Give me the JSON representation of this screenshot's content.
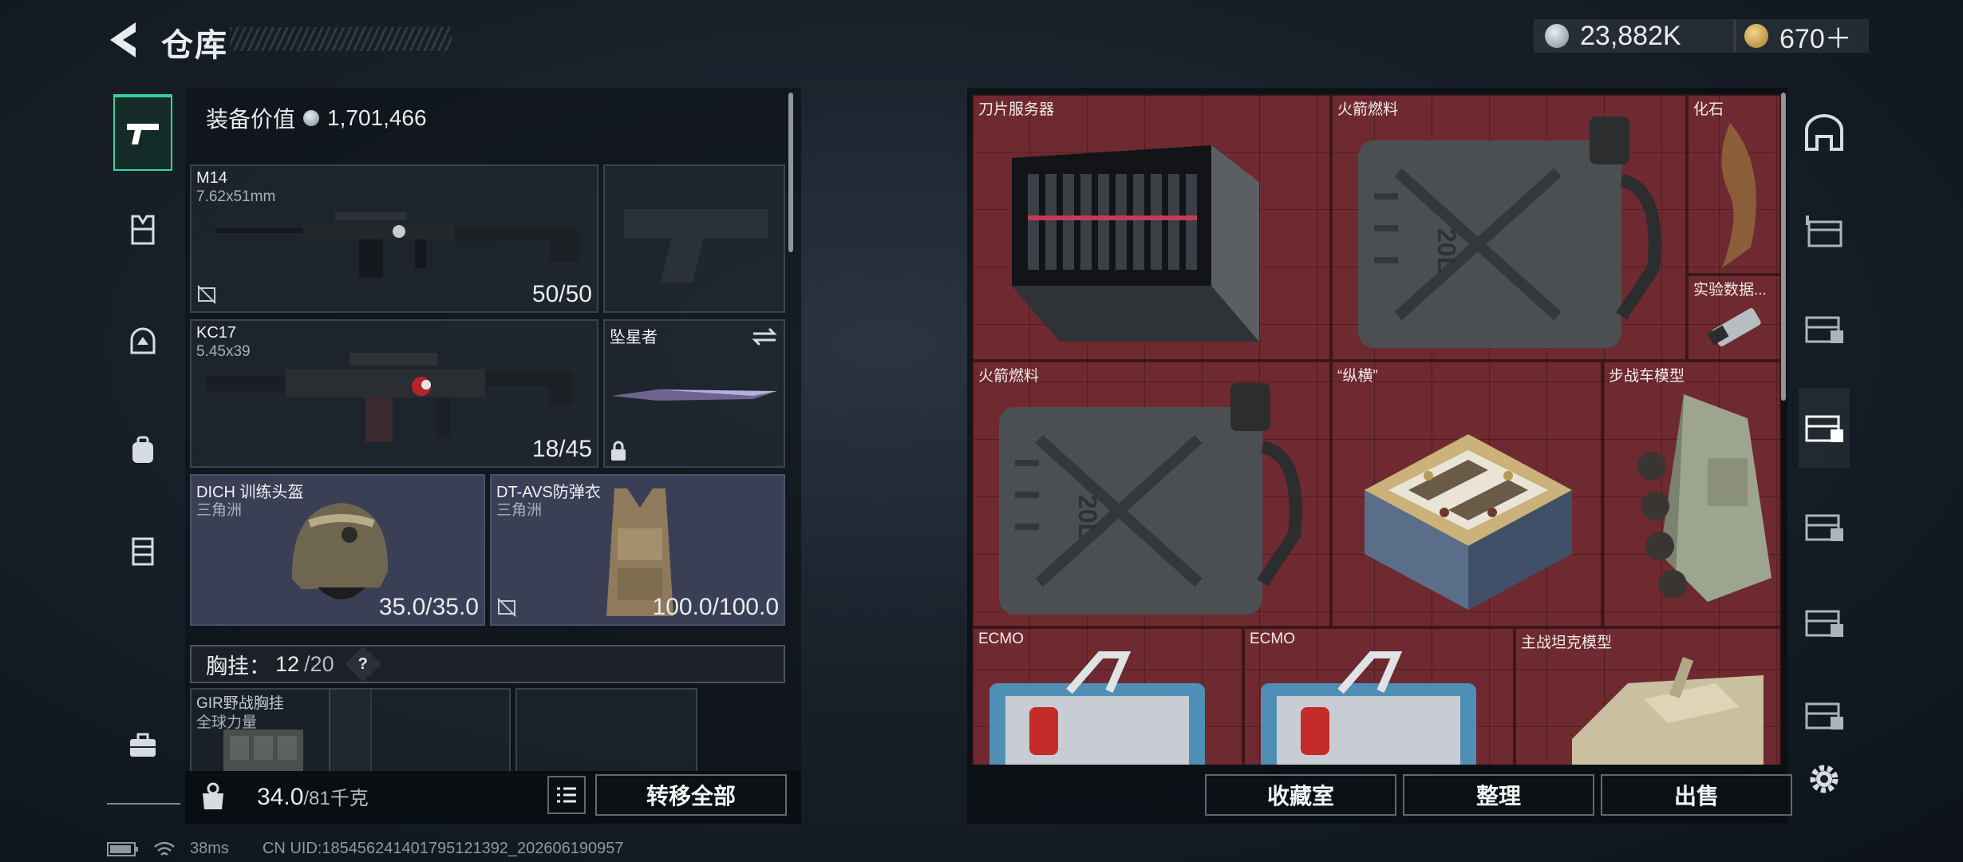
{
  "header": {
    "title": "仓库",
    "currency_coin": "23,882K",
    "currency_gold": "670＋"
  },
  "equipment": {
    "value_label": "装备价值",
    "value": "1,701,466",
    "slots": [
      {
        "name": "M14",
        "sub": "7.62x51mm",
        "durability": "50/50"
      },
      {
        "name": "KC17",
        "sub": "5.45x39",
        "durability": "18/45"
      },
      {
        "name": "坠星者",
        "sub": "",
        "durability": ""
      },
      {
        "name": "DICH 训练头盔",
        "sub": "三角洲",
        "durability": "35.0/35.0"
      },
      {
        "name": "DT-AVS防弹衣",
        "sub": "三角洲",
        "durability": "100.0/100.0"
      }
    ],
    "chest_label": "胸挂：",
    "chest_count": "12",
    "chest_capacity": "/20",
    "chest_help": "?",
    "rig_name": "GIR野战胸挂",
    "rig_sub": "全球力量",
    "weight_value": "34.0",
    "weight_max": "/81千克",
    "transfer_label": "转移全部"
  },
  "storage": {
    "items": [
      {
        "label": "刀片服务器"
      },
      {
        "label": "火箭燃料"
      },
      {
        "label": "化石"
      },
      {
        "label": "实验数据..."
      },
      {
        "label": "火箭燃料"
      },
      {
        "label": "“纵横”"
      },
      {
        "label": "步战车模型"
      },
      {
        "label": "ECMO"
      },
      {
        "label": "ECMO"
      },
      {
        "label": "主战坦克模型"
      }
    ],
    "buttons": {
      "collection": "收藏室",
      "organize": "整理",
      "sell": "出售"
    },
    "jerrycan_volume": "20L"
  },
  "status": {
    "ping": "38ms",
    "uid": "CN UID:185456241401795121392_202606190957"
  },
  "colors": {
    "grid": "#6e2a30",
    "accent": "#34d39a"
  },
  "icons": {
    "left_nav": [
      "pistol-icon",
      "armor-vest-icon",
      "helmet-icon",
      "backpack-icon",
      "chest-rig-icon",
      "briefcase-icon"
    ],
    "right_nav": [
      "safehouse-icon",
      "storage-crate-icon",
      "storage-page-1-icon",
      "storage-page-2-icon",
      "storage-page-3-icon",
      "storage-page-4-icon",
      "storage-page-5-icon",
      "settings-icon"
    ]
  }
}
